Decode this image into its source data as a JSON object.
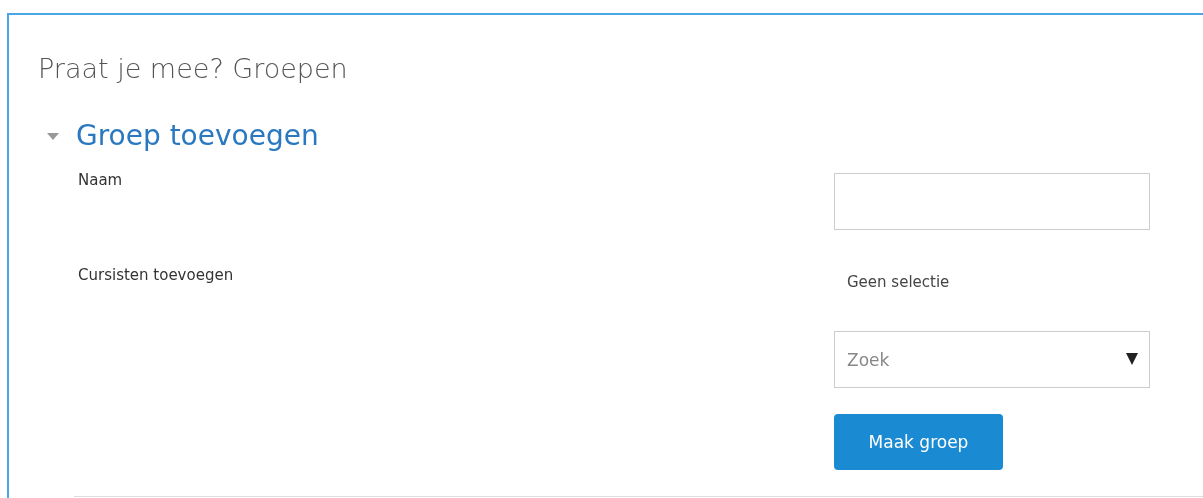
{
  "page_title": "Praat je mee? Groepen",
  "section": {
    "title": "Groep toevoegen",
    "expanded": true
  },
  "fields": [
    {
      "kind": "text",
      "label": "Naam"
    },
    {
      "kind": "autocomplete",
      "label": "Cursisten toevoegen",
      "selection": "Geen selectie",
      "placeholder": "Zoek"
    }
  ],
  "submit": "Maak groep"
}
